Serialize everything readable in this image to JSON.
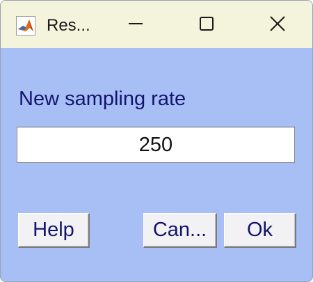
{
  "window": {
    "title": "Res...",
    "app_icon": "matlab-icon",
    "controls": {
      "minimize_icon": "minimize-icon",
      "maximize_icon": "maximize-icon",
      "close_icon": "close-icon"
    }
  },
  "dialog": {
    "prompt": "New sampling rate",
    "input_value": "250",
    "buttons": {
      "help": "Help",
      "cancel": "Can...",
      "ok": "Ok"
    }
  },
  "colors": {
    "titlebar": "#f4f4dc",
    "body": "#a8bff6",
    "label_text": "#14146e",
    "button_face": "#f2f2f4"
  }
}
